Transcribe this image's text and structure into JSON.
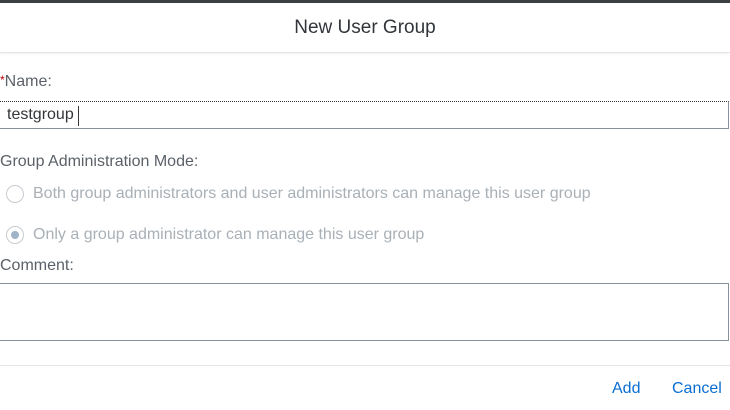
{
  "dialog": {
    "title": "New User Group"
  },
  "name_field": {
    "required_marker": "*",
    "label": "Name:",
    "value": "testgroup"
  },
  "admin_mode": {
    "label": "Group Administration Mode:",
    "options": [
      {
        "label": "Both group administrators and user administrators can manage this user group",
        "selected": false
      },
      {
        "label": "Only a group administrator can manage this user group",
        "selected": true
      }
    ]
  },
  "comment_field": {
    "label": "Comment:",
    "value": ""
  },
  "footer": {
    "add_label": "Add",
    "cancel_label": "Cancel"
  },
  "colors": {
    "accent": "#0a6ed1",
    "required": "#bb0000",
    "disabled_text": "#a9b0b6"
  }
}
